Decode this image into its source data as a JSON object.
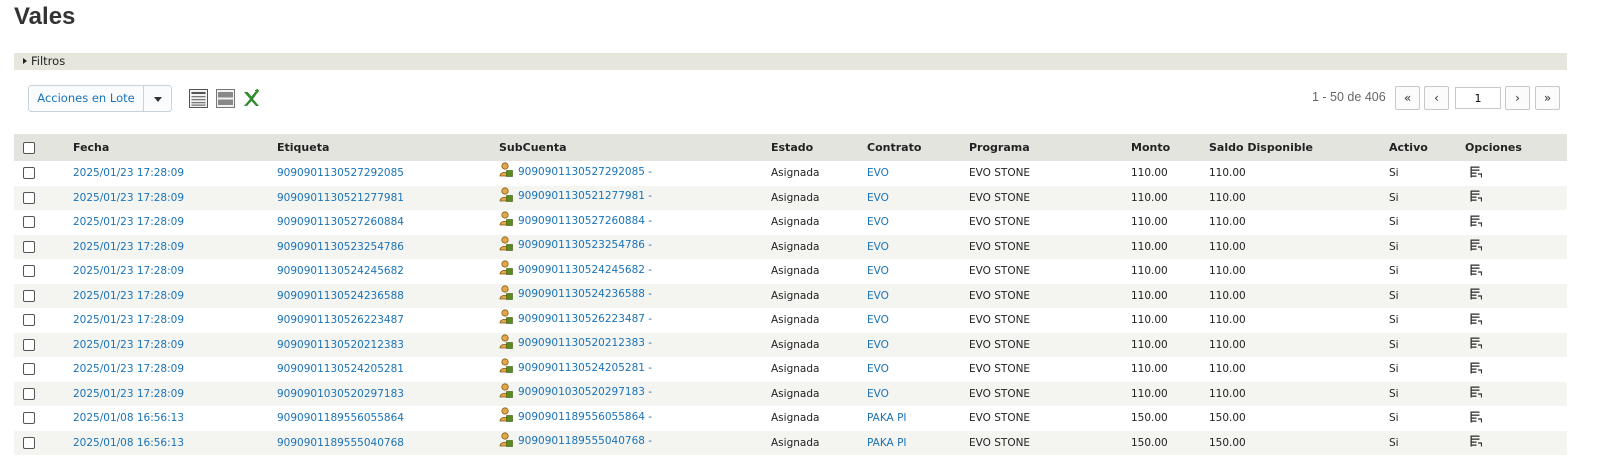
{
  "page": {
    "title": "Vales"
  },
  "filters": {
    "label": "Filtros"
  },
  "toolbar": {
    "batch_actions_label": "Acciones en Lote",
    "icons": [
      "list-view-icon",
      "compact-view-icon",
      "excel-export-icon"
    ]
  },
  "pagination": {
    "range_text": "1 - 50 de 406",
    "first": "«",
    "prev": "‹",
    "current_page": "1",
    "next": "›",
    "last": "»"
  },
  "table": {
    "columns": [
      "Fecha",
      "Etiqueta",
      "SubCuenta",
      "Estado",
      "Contrato",
      "Programa",
      "Monto",
      "Saldo Disponible",
      "Activo",
      "Opciones"
    ],
    "rows": [
      {
        "fecha": "2025/01/23 17:28:09",
        "etiqueta": "9090901130527292085",
        "subcuenta": "9090901130527292085 -",
        "estado": "Asignada",
        "contrato": "EVO",
        "programa": "EVO STONE",
        "monto": "110.00",
        "saldo": "110.00",
        "activo": "Si"
      },
      {
        "fecha": "2025/01/23 17:28:09",
        "etiqueta": "9090901130521277981",
        "subcuenta": "9090901130521277981 -",
        "estado": "Asignada",
        "contrato": "EVO",
        "programa": "EVO STONE",
        "monto": "110.00",
        "saldo": "110.00",
        "activo": "Si"
      },
      {
        "fecha": "2025/01/23 17:28:09",
        "etiqueta": "9090901130527260884",
        "subcuenta": "9090901130527260884 -",
        "estado": "Asignada",
        "contrato": "EVO",
        "programa": "EVO STONE",
        "monto": "110.00",
        "saldo": "110.00",
        "activo": "Si"
      },
      {
        "fecha": "2025/01/23 17:28:09",
        "etiqueta": "9090901130523254786",
        "subcuenta": "9090901130523254786 -",
        "estado": "Asignada",
        "contrato": "EVO",
        "programa": "EVO STONE",
        "monto": "110.00",
        "saldo": "110.00",
        "activo": "Si"
      },
      {
        "fecha": "2025/01/23 17:28:09",
        "etiqueta": "9090901130524245682",
        "subcuenta": "9090901130524245682 -",
        "estado": "Asignada",
        "contrato": "EVO",
        "programa": "EVO STONE",
        "monto": "110.00",
        "saldo": "110.00",
        "activo": "Si"
      },
      {
        "fecha": "2025/01/23 17:28:09",
        "etiqueta": "9090901130524236588",
        "subcuenta": "9090901130524236588 -",
        "estado": "Asignada",
        "contrato": "EVO",
        "programa": "EVO STONE",
        "monto": "110.00",
        "saldo": "110.00",
        "activo": "Si"
      },
      {
        "fecha": "2025/01/23 17:28:09",
        "etiqueta": "9090901130526223487",
        "subcuenta": "9090901130526223487 -",
        "estado": "Asignada",
        "contrato": "EVO",
        "programa": "EVO STONE",
        "monto": "110.00",
        "saldo": "110.00",
        "activo": "Si"
      },
      {
        "fecha": "2025/01/23 17:28:09",
        "etiqueta": "9090901130520212383",
        "subcuenta": "9090901130520212383 -",
        "estado": "Asignada",
        "contrato": "EVO",
        "programa": "EVO STONE",
        "monto": "110.00",
        "saldo": "110.00",
        "activo": "Si"
      },
      {
        "fecha": "2025/01/23 17:28:09",
        "etiqueta": "9090901130524205281",
        "subcuenta": "9090901130524205281 -",
        "estado": "Asignada",
        "contrato": "EVO",
        "programa": "EVO STONE",
        "monto": "110.00",
        "saldo": "110.00",
        "activo": "Si"
      },
      {
        "fecha": "2025/01/23 17:28:09",
        "etiqueta": "9090901030520297183",
        "subcuenta": "9090901030520297183 -",
        "estado": "Asignada",
        "contrato": "EVO",
        "programa": "EVO STONE",
        "monto": "110.00",
        "saldo": "110.00",
        "activo": "Si"
      },
      {
        "fecha": "2025/01/08 16:56:13",
        "etiqueta": "9090901189556055864",
        "subcuenta": "9090901189556055864 -",
        "estado": "Asignada",
        "contrato": "PAKA PI",
        "programa": "EVO STONE",
        "monto": "150.00",
        "saldo": "150.00",
        "activo": "Si"
      },
      {
        "fecha": "2025/01/08 16:56:13",
        "etiqueta": "9090901189555040768",
        "subcuenta": "9090901189555040768 -",
        "estado": "Asignada",
        "contrato": "PAKA PI",
        "programa": "EVO STONE",
        "monto": "150.00",
        "saldo": "150.00",
        "activo": "Si"
      }
    ]
  },
  "colors": {
    "link": "#1a73b8",
    "header_bg": "#e4e4df",
    "row_alt_bg": "#f4f4f1",
    "excel_green": "#2e8b2e"
  }
}
